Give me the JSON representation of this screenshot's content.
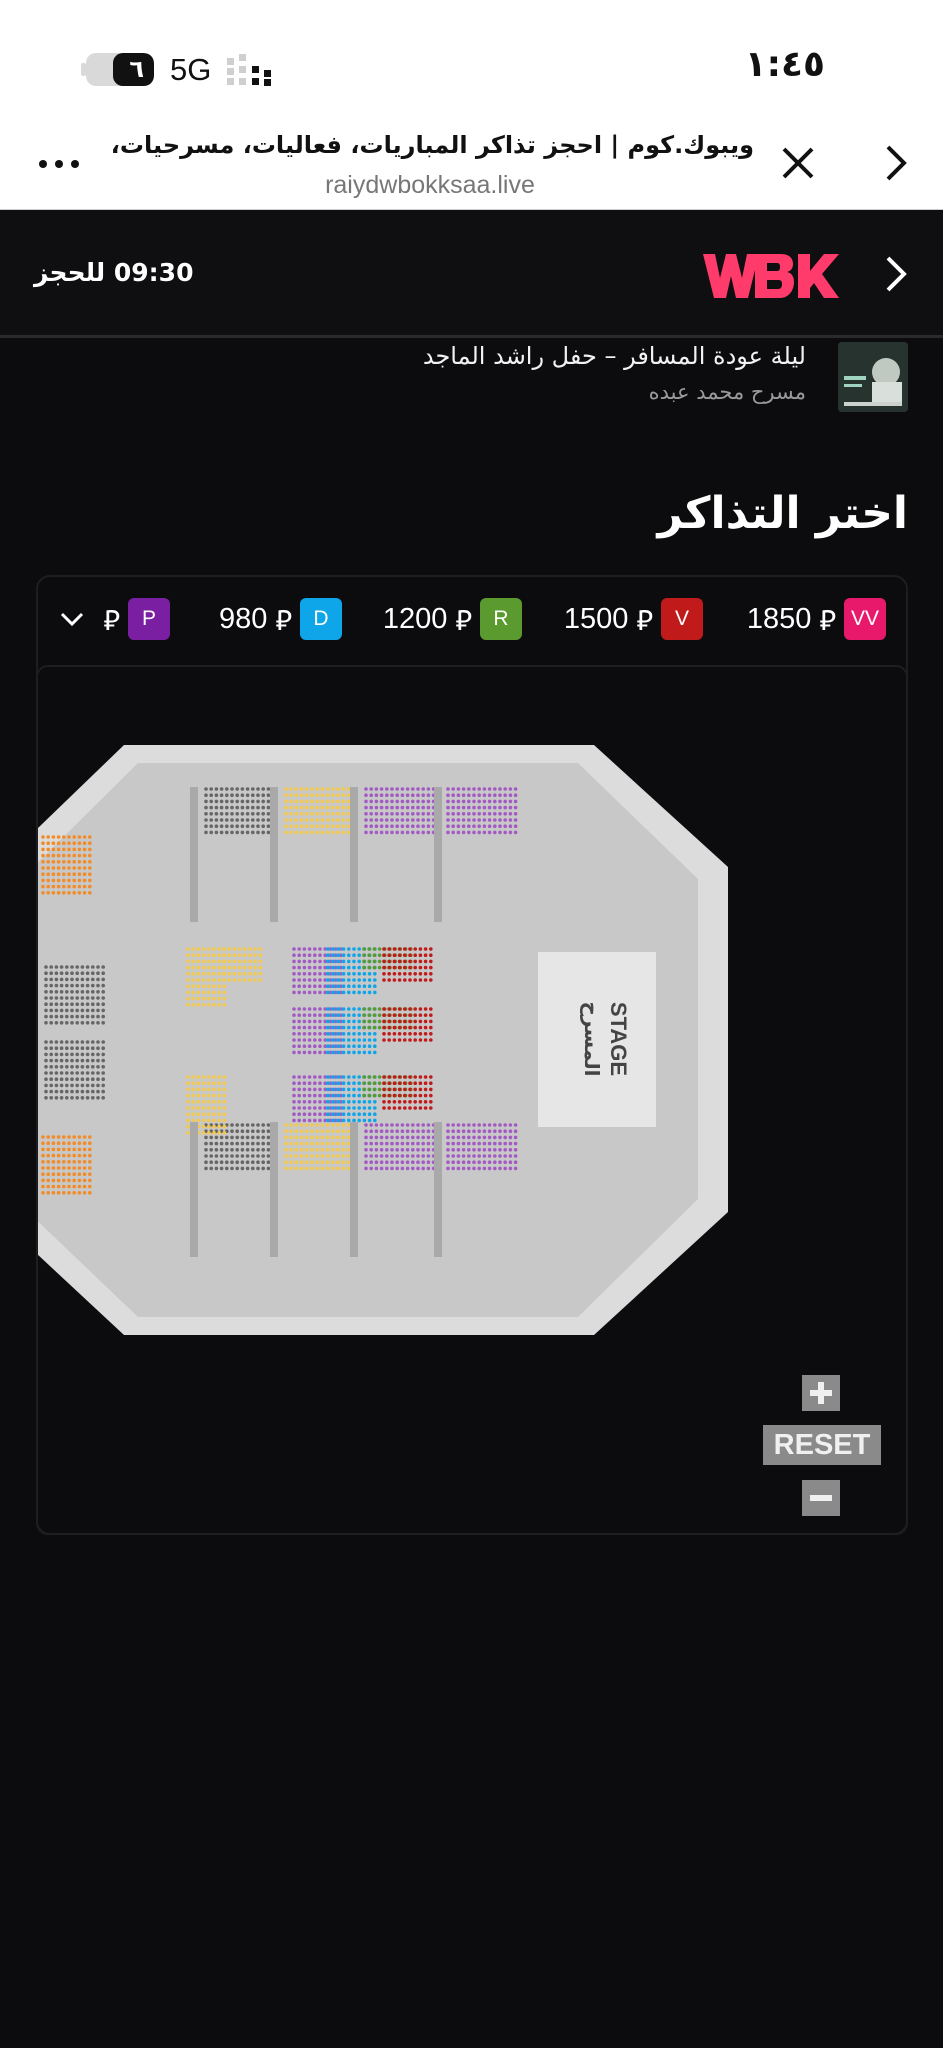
{
  "status": {
    "time": "١:٤٥",
    "network": "5G",
    "battery_level": "٦",
    "battery_fraction": 0.6
  },
  "browser": {
    "page_title": "ويبوك.كوم | احجز تذاكر المباريات، فعاليات، مسرحيات، مطاع...",
    "url": "raiydwbokksaa.live",
    "icons": [
      "more-icon",
      "close-icon",
      "chevron-right-icon"
    ]
  },
  "header": {
    "timer_text": "09:30 للحجز",
    "logo_text": "WBK",
    "logo_color": "#ff3b6b"
  },
  "event": {
    "title": "ليلة عودة المسافر – حفل راشد الماجد",
    "venue": "مسرح محمد عبده"
  },
  "section_title": "اختر التذاكر",
  "price_tiers": [
    {
      "code": "VV",
      "price": "1850",
      "color": "#e8196b"
    },
    {
      "code": "V",
      "price": "1500",
      "color": "#c01a1a"
    },
    {
      "code": "R",
      "price": "1200",
      "color": "#5a9a2e"
    },
    {
      "code": "D",
      "price": "980",
      "color": "#0ea5e9"
    },
    {
      "code": "P",
      "price": "",
      "color": "#7b1fa2"
    }
  ],
  "currency_symbol": "⃁",
  "stage": {
    "en": "STAGE",
    "ar": "المسرح"
  },
  "zoom": {
    "plus": "+",
    "reset": "RESET",
    "minus": "−"
  }
}
